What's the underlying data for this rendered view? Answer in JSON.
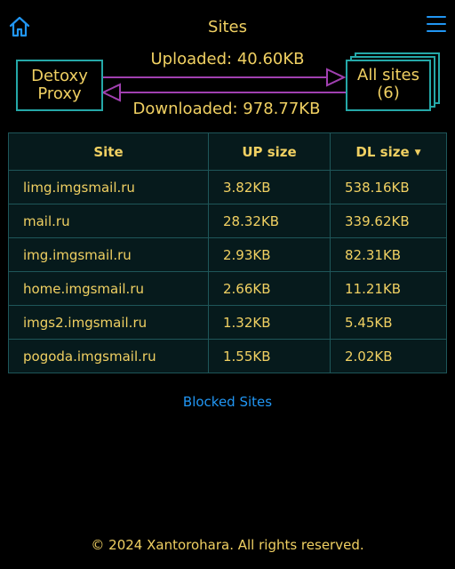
{
  "header": {
    "title": "Sites",
    "home_icon": "home-icon",
    "menu_icon": "hamburger-menu-icon",
    "accent_color": "#2196f3"
  },
  "flow": {
    "source_line1": "Detoxy",
    "source_line2": "Proxy",
    "target_line1": "All sites",
    "target_line2": "(6)",
    "uploaded": "Uploaded: 40.60KB",
    "downloaded": "Downloaded: 978.77KB",
    "box_color": "#25a8a8",
    "arrow_color": "#a040b0"
  },
  "table": {
    "headers": [
      "Site",
      "UP size",
      "DL size"
    ],
    "sorted_column": "DL size",
    "sort_indicator": "▼",
    "rows": [
      [
        "limg.imgsmail.ru",
        "3.82KB",
        "538.16KB"
      ],
      [
        "mail.ru",
        "28.32KB",
        "339.62KB"
      ],
      [
        "img.imgsmail.ru",
        "2.93KB",
        "82.31KB"
      ],
      [
        "home.imgsmail.ru",
        "2.66KB",
        "11.21KB"
      ],
      [
        "imgs2.imgsmail.ru",
        "1.32KB",
        "5.45KB"
      ],
      [
        "pogoda.imgsmail.ru",
        "1.55KB",
        "2.02KB"
      ]
    ]
  },
  "links": {
    "blocked_sites": "Blocked Sites"
  },
  "footer": {
    "copyright": "© 2024 Xantorohara. All rights reserved."
  }
}
